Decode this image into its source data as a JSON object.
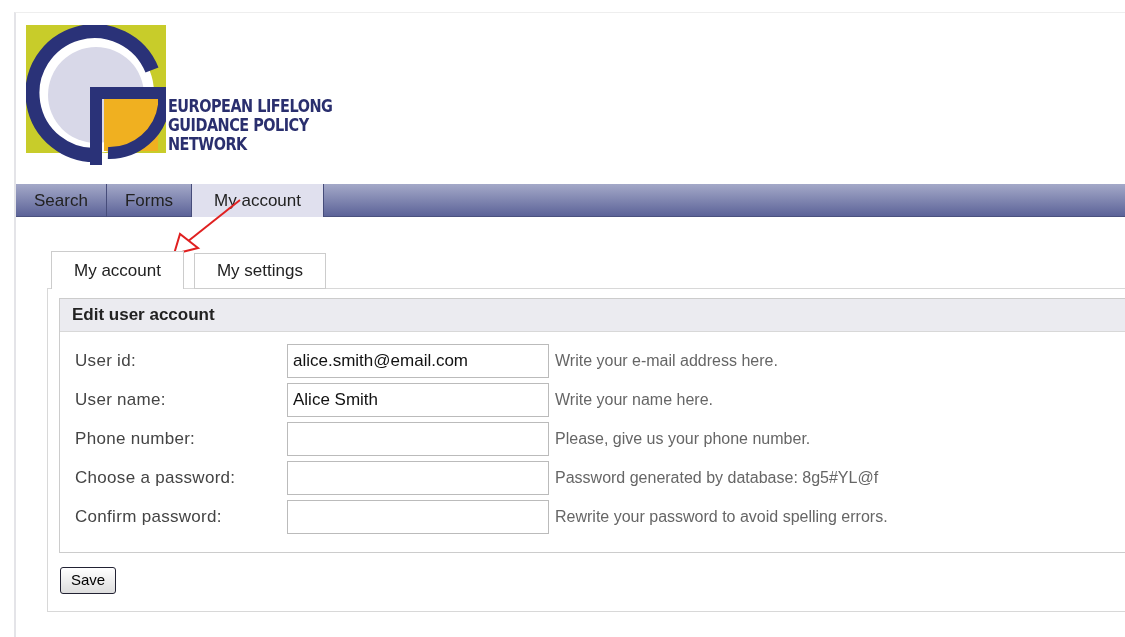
{
  "logo": {
    "text_lines": [
      "EUROPEAN LIFELONG",
      "GUIDANCE POLICY",
      "NETWORK"
    ]
  },
  "nav_tabs": [
    {
      "label": "Search",
      "selected": false
    },
    {
      "label": "Forms",
      "selected": false
    },
    {
      "label": "My account",
      "selected": true
    }
  ],
  "sub_tabs": [
    {
      "label": "My account",
      "selected": true
    },
    {
      "label": "My settings",
      "selected": false
    }
  ],
  "form": {
    "title": "Edit user account",
    "fields": [
      {
        "label": "User id:",
        "value": "alice.smith@email.com",
        "hint": "Write your e-mail address here."
      },
      {
        "label": "User name:",
        "value": "Alice Smith",
        "hint": "Write your name here."
      },
      {
        "label": "Phone number:",
        "hint": "Please, give us your phone number."
      },
      {
        "label": "Choose a password:",
        "hint": "Password generated by database: 8g5#YL@f"
      },
      {
        "label": "Confirm password:",
        "hint": "Rewrite your password to avoid spelling errors."
      }
    ]
  },
  "buttons": [
    {
      "label": "Save"
    }
  ]
}
